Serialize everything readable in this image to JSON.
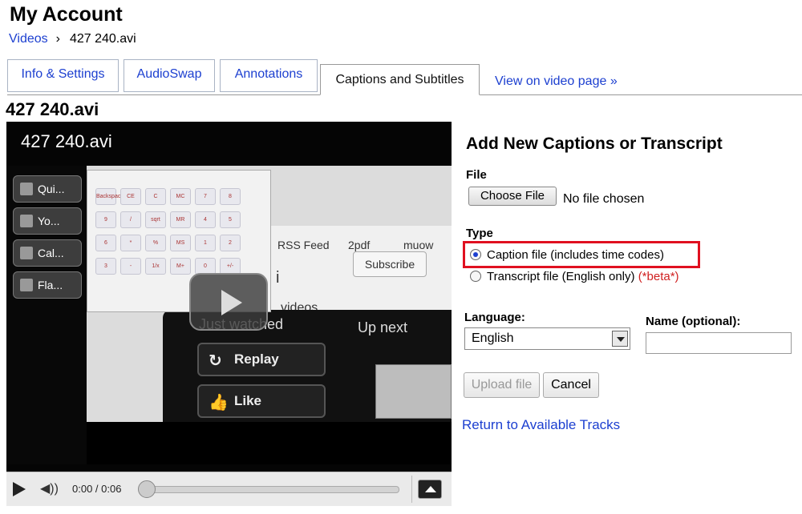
{
  "header": {
    "title": "My Account"
  },
  "breadcrumb": {
    "parent": "Videos",
    "separator": "›",
    "current": "427 240.avi"
  },
  "tabs": [
    {
      "label": "Info & Settings",
      "active": false
    },
    {
      "label": "AudioSwap",
      "active": false
    },
    {
      "label": "Annotations",
      "active": false
    },
    {
      "label": "Captions and Subtitles",
      "active": true
    }
  ],
  "tab_link": {
    "label": "View on video page »"
  },
  "video": {
    "title": "427 240.avi",
    "player_title": "427 240.avi",
    "time": "0:00 / 0:06",
    "progress": 0,
    "taskbar": [
      "Qui...",
      "Yo...",
      "Cal...",
      "Fla..."
    ],
    "browser": {
      "rss": "RSS Feed",
      "folder1": "2pdf",
      "folder2": "muow",
      "videos": "videos",
      "letter": "i",
      "subscribe": "Subscribe"
    },
    "endscreen": {
      "just_watched": "Just watched",
      "up_next": "Up next",
      "replay": "Replay",
      "like": "Like"
    },
    "calc_keys": [
      "Backspace",
      "CE",
      "C",
      "MC",
      "7",
      "8",
      "9",
      "/",
      "sqrt",
      "MR",
      "4",
      "5",
      "6",
      "*",
      "%",
      "MS",
      "1",
      "2",
      "3",
      "-",
      "1/x",
      "M+",
      "0",
      "+/-",
      ".",
      "+",
      "="
    ]
  },
  "panel": {
    "title": "Add New Captions or Transcript",
    "file_label": "File",
    "choose_file": "Choose File",
    "file_status": "No file chosen",
    "type_label": "Type",
    "caption_option": "Caption file",
    "caption_note": "(includes time codes)",
    "transcript_option": "Transcript file",
    "transcript_note": "(English only)",
    "transcript_beta": "(*beta*)",
    "language_label": "Language:",
    "language_value": "English",
    "name_label": "Name (optional):",
    "name_value": "",
    "upload_button": "Upload file",
    "cancel_button": "Cancel",
    "return_link": "Return to Available Tracks"
  },
  "colors": {
    "link": "#1c3fd0",
    "highlight": "#e01020",
    "beta": "#d02020"
  }
}
